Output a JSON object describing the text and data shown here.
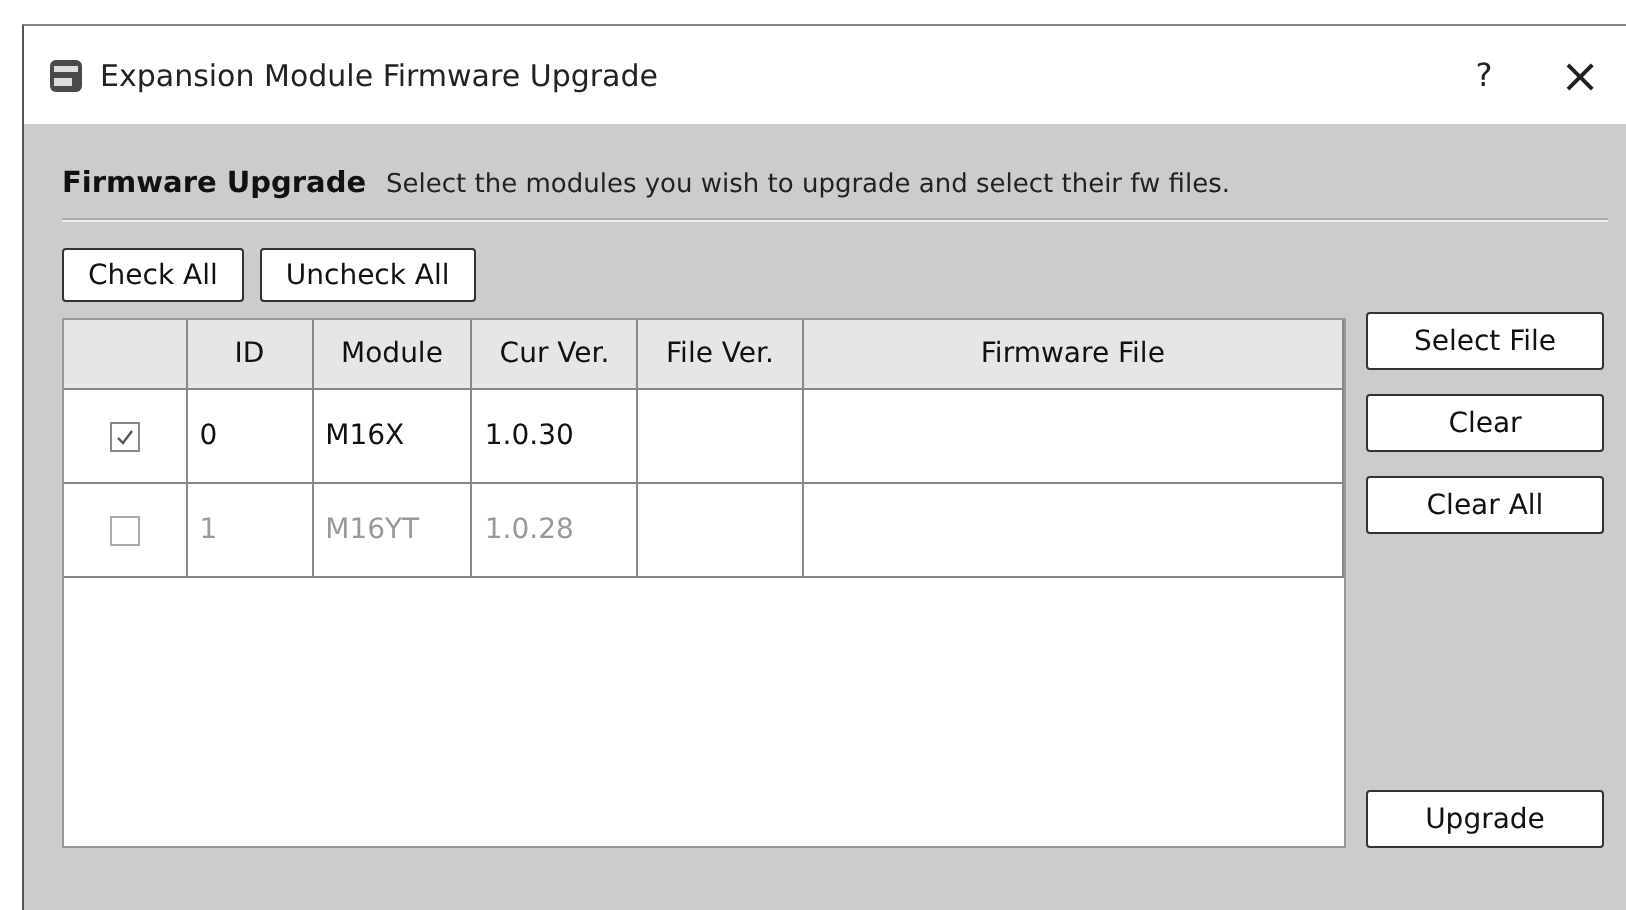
{
  "window": {
    "title": "Expansion Module Firmware Upgrade",
    "help": "?",
    "close": "×"
  },
  "header": {
    "title": "Firmware Upgrade",
    "description": "Select the modules you wish to upgrade and select their fw files."
  },
  "top_buttons": [
    "Check All",
    "Uncheck All"
  ],
  "table": {
    "columns": [
      "ID",
      "Module",
      "Cur Ver.",
      "File Ver.",
      "Firmware File"
    ],
    "rows": [
      {
        "checked": true,
        "disabled": false,
        "cells": [
          "0",
          "M16X",
          "1.0.30",
          "",
          ""
        ]
      },
      {
        "checked": false,
        "disabled": true,
        "cells": [
          "1",
          "M16YT",
          "1.0.28",
          "",
          ""
        ]
      }
    ]
  },
  "side_buttons": [
    "Select File",
    "Clear",
    "Clear All"
  ],
  "upgrade_button": "Upgrade"
}
